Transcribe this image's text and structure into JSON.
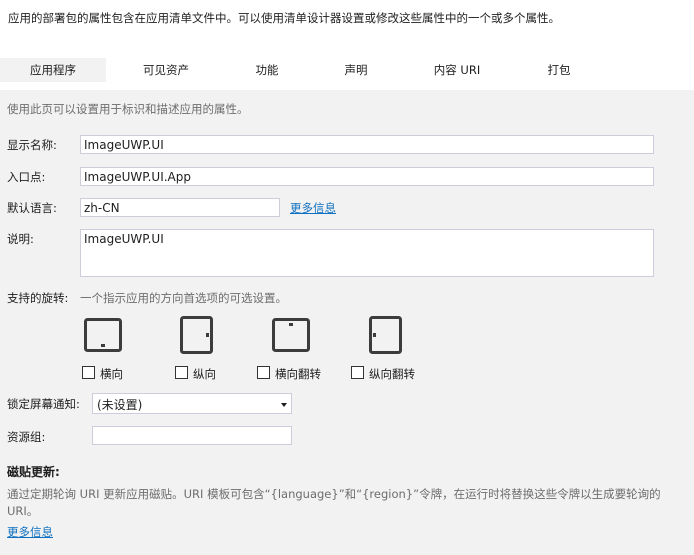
{
  "header": {
    "intro": "应用的部署包的属性包含在应用清单文件中。可以使用清单设计器设置或修改这些属性中的一个或多个属性。"
  },
  "tabs": [
    {
      "label": "应用程序",
      "active": true
    },
    {
      "label": "可见资产",
      "active": false
    },
    {
      "label": "功能",
      "active": false
    },
    {
      "label": "声明",
      "active": false
    },
    {
      "label": "内容 URI",
      "active": false
    },
    {
      "label": "打包",
      "active": false
    }
  ],
  "app": {
    "description": "使用此页可以设置用于标识和描述应用的属性。",
    "display_name_label": "显示名称:",
    "display_name_value": "ImageUWP.UI",
    "entry_point_label": "入口点:",
    "entry_point_value": "ImageUWP.UI.App",
    "language_label": "默认语言:",
    "language_value": "zh-CN",
    "language_more": "更多信息",
    "desc_label": "说明:",
    "desc_value": "ImageUWP.UI"
  },
  "rotation": {
    "label": "支持的旋转:",
    "hint": "一个指示应用的方向首选项的可选设置。",
    "options": [
      {
        "label": "横向",
        "icon": "landscape-device-icon",
        "checked": false
      },
      {
        "label": "纵向",
        "icon": "portrait-device-icon",
        "checked": false
      },
      {
        "label": "横向翻转",
        "icon": "landscape-flipped-device-icon",
        "checked": false
      },
      {
        "label": "纵向翻转",
        "icon": "portrait-flipped-device-icon",
        "checked": false
      }
    ]
  },
  "lock_screen": {
    "label": "锁定屏幕通知:",
    "value": "(未设置)"
  },
  "resource_group": {
    "label": "资源组:",
    "value": ""
  },
  "tile_update": {
    "title": "磁贴更新:",
    "text": "通过定期轮询 URI 更新应用磁贴。URI 模板可包含“{language}”和“{region}”令牌，在运行时将替换这些令牌以生成要轮询的 URI。",
    "more": "更多信息"
  },
  "colors": {
    "link": "#0e70c0",
    "hint": "#6d6d6d",
    "device": "#3c3c3c"
  }
}
